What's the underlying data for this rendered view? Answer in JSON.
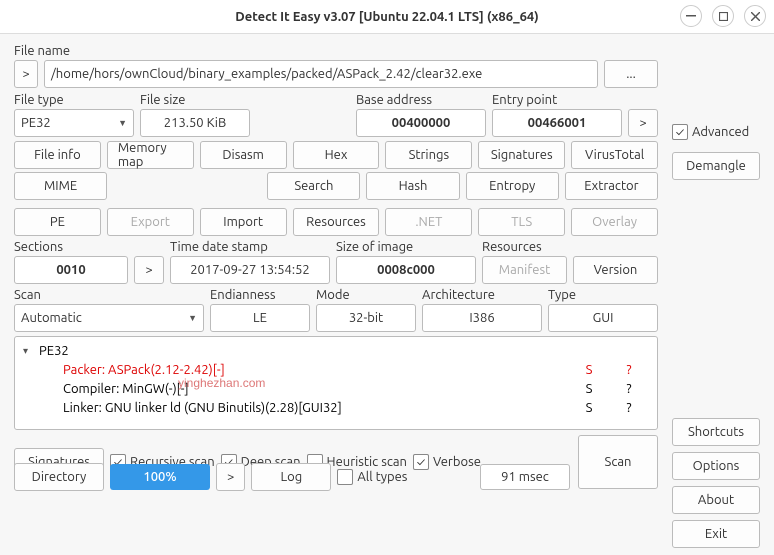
{
  "window": {
    "title": "Detect It Easy v3.07 [Ubuntu 22.04.1 LTS] (x86_64)"
  },
  "filename": {
    "label": "File name",
    "value": "/home/hors/ownCloud/binary_examples/packed/ASPack_2.42/clear32.exe",
    "goto": ">",
    "browse": "..."
  },
  "filetype": {
    "label": "File type",
    "value": "PE32"
  },
  "filesize": {
    "label": "File size",
    "value": "213.50 KiB"
  },
  "baseaddr": {
    "label": "Base address",
    "value": "00400000"
  },
  "entry": {
    "label": "Entry point",
    "value": "00466001",
    "goto": ">"
  },
  "advanced": {
    "label": "Advanced",
    "checked": "✓"
  },
  "demangle": {
    "label": "Demangle"
  },
  "tools1": {
    "fileinfo": "File info",
    "memmap": "Memory map",
    "disasm": "Disasm",
    "hex": "Hex",
    "strings": "Strings",
    "sigs": "Signatures",
    "vt": "VirusTotal",
    "mime": "MIME",
    "search": "Search",
    "hash": "Hash",
    "entropy": "Entropy",
    "extract": "Extractor"
  },
  "tools2": {
    "pe": "PE",
    "export": "Export",
    "import": "Import",
    "res": "Resources",
    "net": ".NET",
    "tls": "TLS",
    "overlay": "Overlay"
  },
  "sections": {
    "label": "Sections",
    "value": "0010",
    "goto": ">"
  },
  "timestamp": {
    "label": "Time date stamp",
    "value": "2017-09-27 13:54:52"
  },
  "sizeimg": {
    "label": "Size of image",
    "value": "0008c000"
  },
  "resources": {
    "label": "Resources",
    "manifest": "Manifest",
    "version": "Version"
  },
  "scan": {
    "label": "Scan",
    "mode": "Automatic",
    "endian_label": "Endianness",
    "endian": "LE",
    "mode_label": "Mode",
    "bits": "32-bit",
    "arch_label": "Architecture",
    "arch": "I386",
    "type_label": "Type",
    "type": "GUI"
  },
  "tree": {
    "root": "PE32",
    "rows": [
      {
        "text": "Packer: ASPack(2.12-2.42)[-]",
        "s": "S",
        "q": "?",
        "red": true
      },
      {
        "text": "Compiler: MinGW(-)[-]",
        "s": "S",
        "q": "?",
        "red": false
      },
      {
        "text": "Linker: GNU linker ld (GNU Binutils)(2.28)[GUI32]",
        "s": "S",
        "q": "?",
        "red": false
      }
    ]
  },
  "bottom": {
    "signatures": "Signatures",
    "recursive": {
      "label": "Recursive scan",
      "checked": "✓"
    },
    "deep": {
      "label": "Deep scan",
      "checked": "✓"
    },
    "heuristic": {
      "label": "Heuristic scan",
      "checked": ""
    },
    "verbose": {
      "label": "Verbose",
      "checked": "✓"
    },
    "scan": "Scan",
    "directory": "Directory",
    "progress": "100%",
    "goto": ">",
    "log": "Log",
    "alltypes": {
      "label": "All types",
      "checked": ""
    },
    "time": "91 msec"
  },
  "side": {
    "shortcuts": "Shortcuts",
    "options": "Options",
    "about": "About",
    "exit": "Exit"
  },
  "watermark": "yinghezhan.com"
}
